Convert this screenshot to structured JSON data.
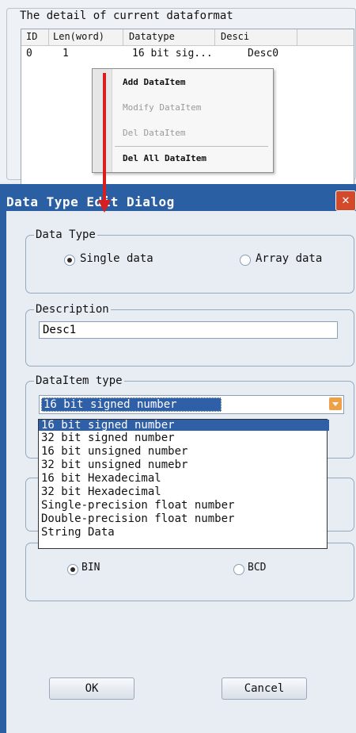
{
  "table_panel": {
    "group_title": "The detail of current dataformat",
    "columns": [
      "ID",
      "Len(word)",
      "Datatype",
      "Desci"
    ],
    "rows": [
      [
        "0",
        "1",
        "16 bit sig...",
        "Desc0"
      ]
    ]
  },
  "context_menu": {
    "items": [
      {
        "label": "Add DataItem",
        "enabled": true
      },
      {
        "label": "Modify DataItem",
        "enabled": false
      },
      {
        "label": "Del DataItem",
        "enabled": false
      },
      {
        "label": "Del All DataItem",
        "enabled": true
      }
    ]
  },
  "dialog": {
    "title": "Data Type Edit Dialog",
    "close_icon": "close-icon",
    "data_type": {
      "title": "Data Type",
      "options": [
        "Single data",
        "Array data"
      ],
      "selected": "Single data"
    },
    "description": {
      "title": "Description",
      "value": "Desc1"
    },
    "dataitem_type": {
      "title": "DataItem type",
      "selected": "16 bit signed number",
      "options": [
        "16 bit signed number",
        "32 bit signed number",
        "16 bit unsigned number",
        "32 bit unsigned numebr",
        "16 bit Hexadecimal",
        "32 bit Hexadecimal",
        "Single-precision float number",
        "Double-precision float number",
        "String Data"
      ]
    },
    "code_type": {
      "options": [
        "BIN",
        "BCD"
      ],
      "selected": "BIN"
    },
    "ok_label": "OK",
    "cancel_label": "Cancel"
  },
  "colors": {
    "title_bar": "#2b5fa3",
    "selection": "#2f5fa6",
    "arrow": "#d81e1e",
    "close_button": "#d5492b"
  }
}
